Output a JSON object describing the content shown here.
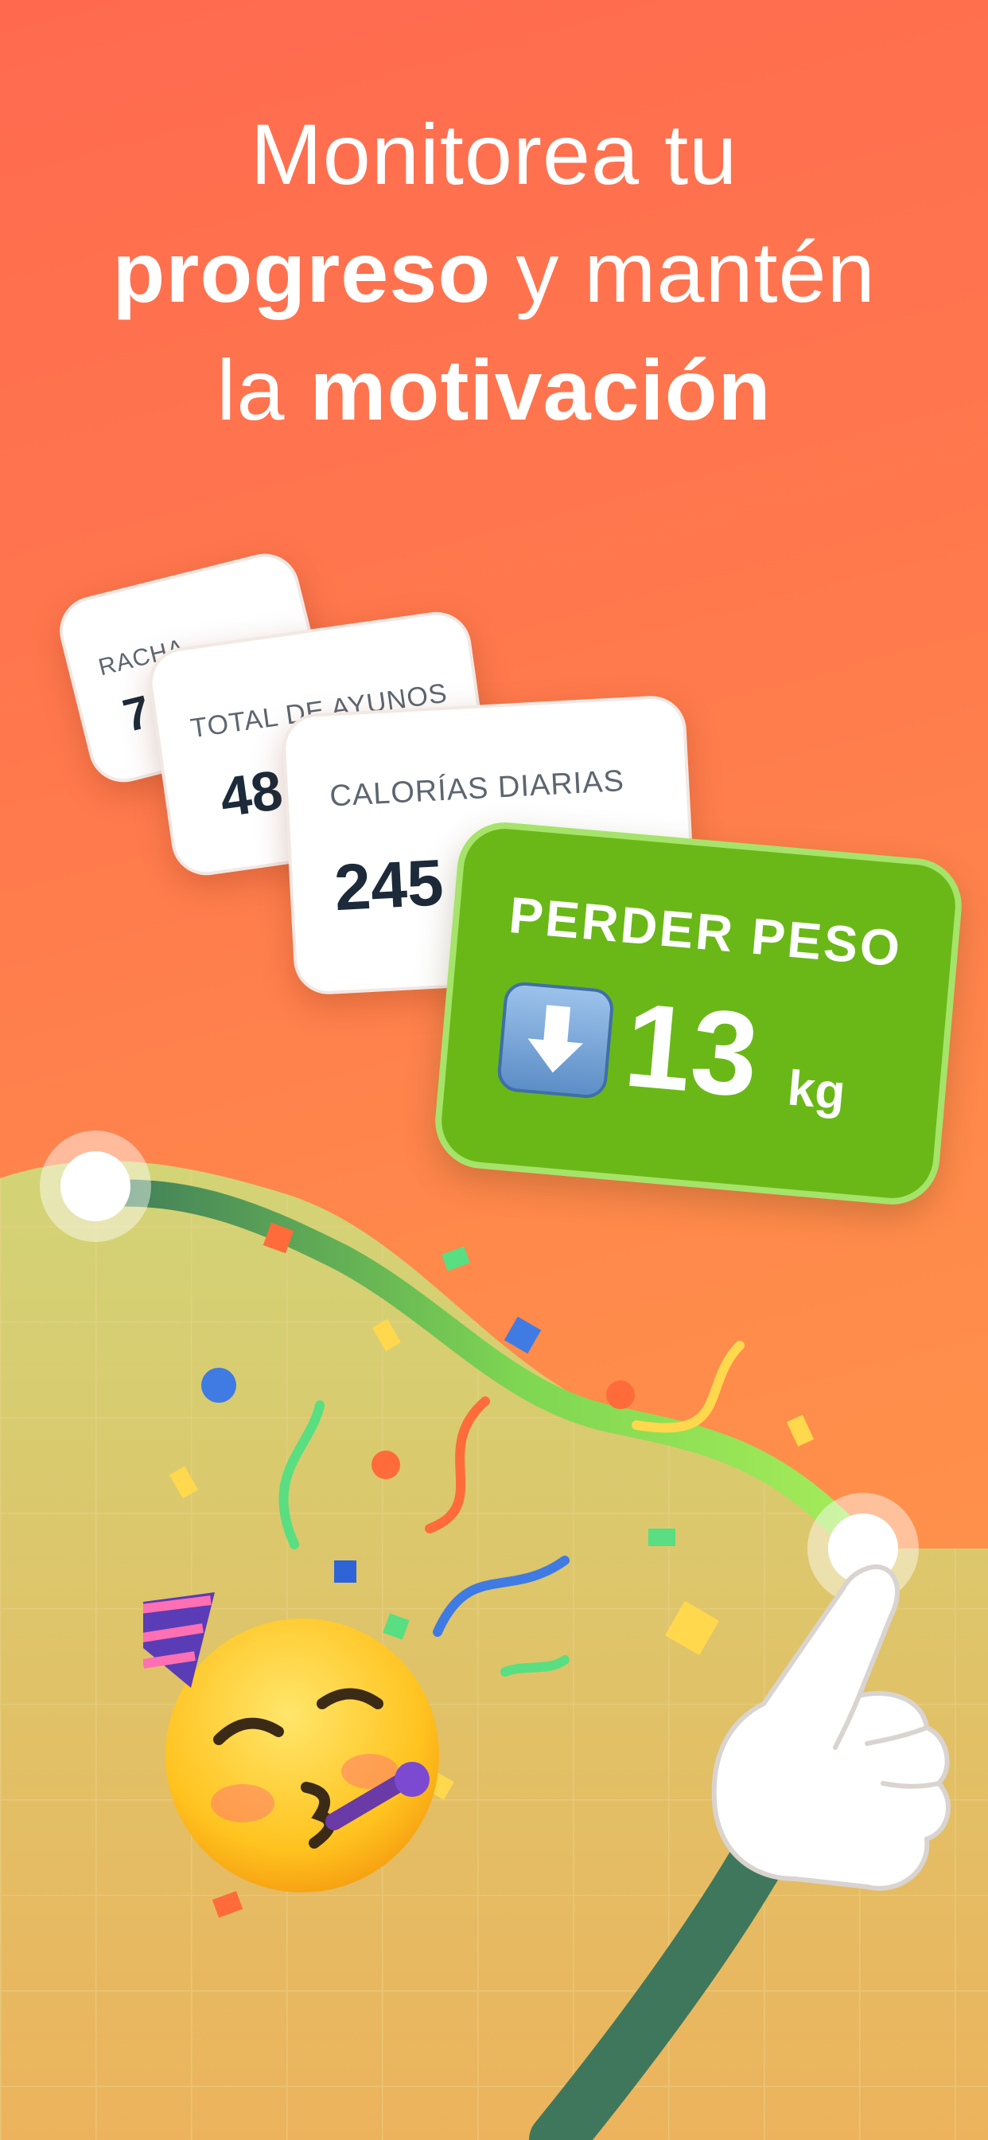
{
  "headline": {
    "line1": "Monitorea tu",
    "line2_bold": "progreso",
    "line2_rest": " y mantén",
    "line3_pre": "la ",
    "line3_bold": "motivación"
  },
  "cards": [
    {
      "label": "RACHA",
      "value": "7"
    },
    {
      "label": "TOTAL DE AYUNOS",
      "value": "48"
    },
    {
      "label": "CALORÍAS DIARIAS",
      "value": "245"
    }
  ],
  "goal": {
    "title": "PERDER PESO",
    "value": "13",
    "unit": "kg",
    "icon": "down-arrow-icon"
  },
  "colors": {
    "background_top": "#ff6a4f",
    "background_bottom": "#ff9a4c",
    "goal_green": "#6ab817",
    "curve_dark": "#3e7a5a",
    "curve_light": "#9be84f",
    "chart_fill": "#d7cf72"
  },
  "decorations": {
    "emoji": "partying-face-icon",
    "hand": "pointing-hand-icon"
  }
}
